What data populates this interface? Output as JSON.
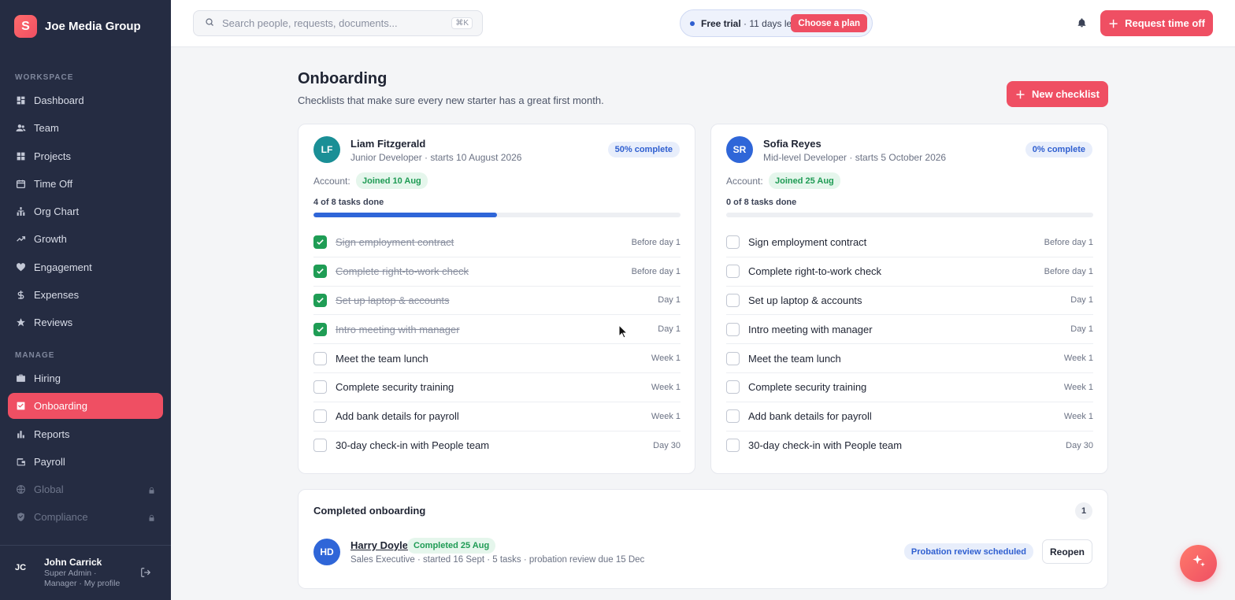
{
  "brand": {
    "name": "Joe Media Group",
    "logo_letter": "S"
  },
  "sidebar": {
    "workspace_label": "WORKSPACE",
    "workspace_items": [
      {
        "label": "Dashboard",
        "icon": "dashboard-icon"
      },
      {
        "label": "Team",
        "icon": "team-icon"
      },
      {
        "label": "Projects",
        "icon": "projects-icon"
      },
      {
        "label": "Time Off",
        "icon": "calendar-icon"
      },
      {
        "label": "Org Chart",
        "icon": "org-chart-icon"
      },
      {
        "label": "Growth",
        "icon": "growth-icon"
      },
      {
        "label": "Engagement",
        "icon": "heart-icon"
      },
      {
        "label": "Expenses",
        "icon": "dollar-icon"
      },
      {
        "label": "Reviews",
        "icon": "star-icon"
      }
    ],
    "manage_label": "MANAGE",
    "manage_items": [
      {
        "label": "Hiring",
        "icon": "briefcase-icon"
      },
      {
        "label": "Onboarding",
        "icon": "checkbox-icon",
        "active": true
      },
      {
        "label": "Reports",
        "icon": "bar-chart-icon"
      },
      {
        "label": "Payroll",
        "icon": "wallet-icon"
      },
      {
        "label": "Global",
        "icon": "globe-icon",
        "locked": true
      },
      {
        "label": "Compliance",
        "icon": "shield-icon",
        "locked": true
      }
    ],
    "user": {
      "initials": "JC",
      "name": "John Carrick",
      "role": "Super Admin · Manager · My profile"
    }
  },
  "topbar": {
    "search_placeholder": "Search people, requests, documents...",
    "search_shortcut": "⌘K",
    "trial_bold": "Free trial",
    "trial_rest": "· 11 days left",
    "trial_button": "Choose a plan",
    "request_button": "Request time off"
  },
  "page": {
    "title": "Onboarding",
    "subtitle": "Checklists that make sure every new starter has a great first month.",
    "new_button": "New checklist"
  },
  "checklists": [
    {
      "initials": "LF",
      "avatar_color": "#1a8f96",
      "name": "Liam Fitzgerald",
      "role": "Junior Developer · starts 10 August 2026",
      "percent_label": "50% complete",
      "progress": 0.5,
      "account_label": "Account:",
      "joined": "Joined 10 Aug",
      "tasks_done": "4 of 8 tasks done",
      "tasks": [
        {
          "label": "Sign employment contract",
          "when": "Before day 1",
          "done": true
        },
        {
          "label": "Complete right-to-work check",
          "when": "Before day 1",
          "done": true
        },
        {
          "label": "Set up laptop & accounts",
          "when": "Day 1",
          "done": true
        },
        {
          "label": "Intro meeting with manager",
          "when": "Day 1",
          "done": true
        },
        {
          "label": "Meet the team lunch",
          "when": "Week 1",
          "done": false
        },
        {
          "label": "Complete security training",
          "when": "Week 1",
          "done": false
        },
        {
          "label": "Add bank details for payroll",
          "when": "Week 1",
          "done": false
        },
        {
          "label": "30-day check-in with People team",
          "when": "Day 30",
          "done": false
        }
      ]
    },
    {
      "initials": "SR",
      "avatar_color": "#2f66d8",
      "name": "Sofia Reyes",
      "role": "Mid-level Developer · starts 5 October 2026",
      "percent_label": "0% complete",
      "progress": 0,
      "account_label": "Account:",
      "joined": "Joined 25 Aug",
      "tasks_done": "0 of 8 tasks done",
      "tasks": [
        {
          "label": "Sign employment contract",
          "when": "Before day 1",
          "done": false
        },
        {
          "label": "Complete right-to-work check",
          "when": "Before day 1",
          "done": false
        },
        {
          "label": "Set up laptop & accounts",
          "when": "Day 1",
          "done": false
        },
        {
          "label": "Intro meeting with manager",
          "when": "Day 1",
          "done": false
        },
        {
          "label": "Meet the team lunch",
          "when": "Week 1",
          "done": false
        },
        {
          "label": "Complete security training",
          "when": "Week 1",
          "done": false
        },
        {
          "label": "Add bank details for payroll",
          "when": "Week 1",
          "done": false
        },
        {
          "label": "30-day check-in with People team",
          "when": "Day 30",
          "done": false
        }
      ]
    }
  ],
  "completed": {
    "title": "Completed onboarding",
    "count": "1",
    "person": {
      "initials": "HD",
      "avatar_color": "#2f66d8",
      "name": "Harry Doyle",
      "badge": "Completed 25 Aug",
      "details": "Sales Executive · started 16 Sept · 5 tasks · probation review due 15 Dec",
      "status": "Probation review scheduled",
      "action": "Reopen"
    }
  },
  "colors": {
    "accent": "#ef4f63",
    "sidebar": "#252c42",
    "success": "#1f9d55",
    "info": "#2f66d8"
  }
}
